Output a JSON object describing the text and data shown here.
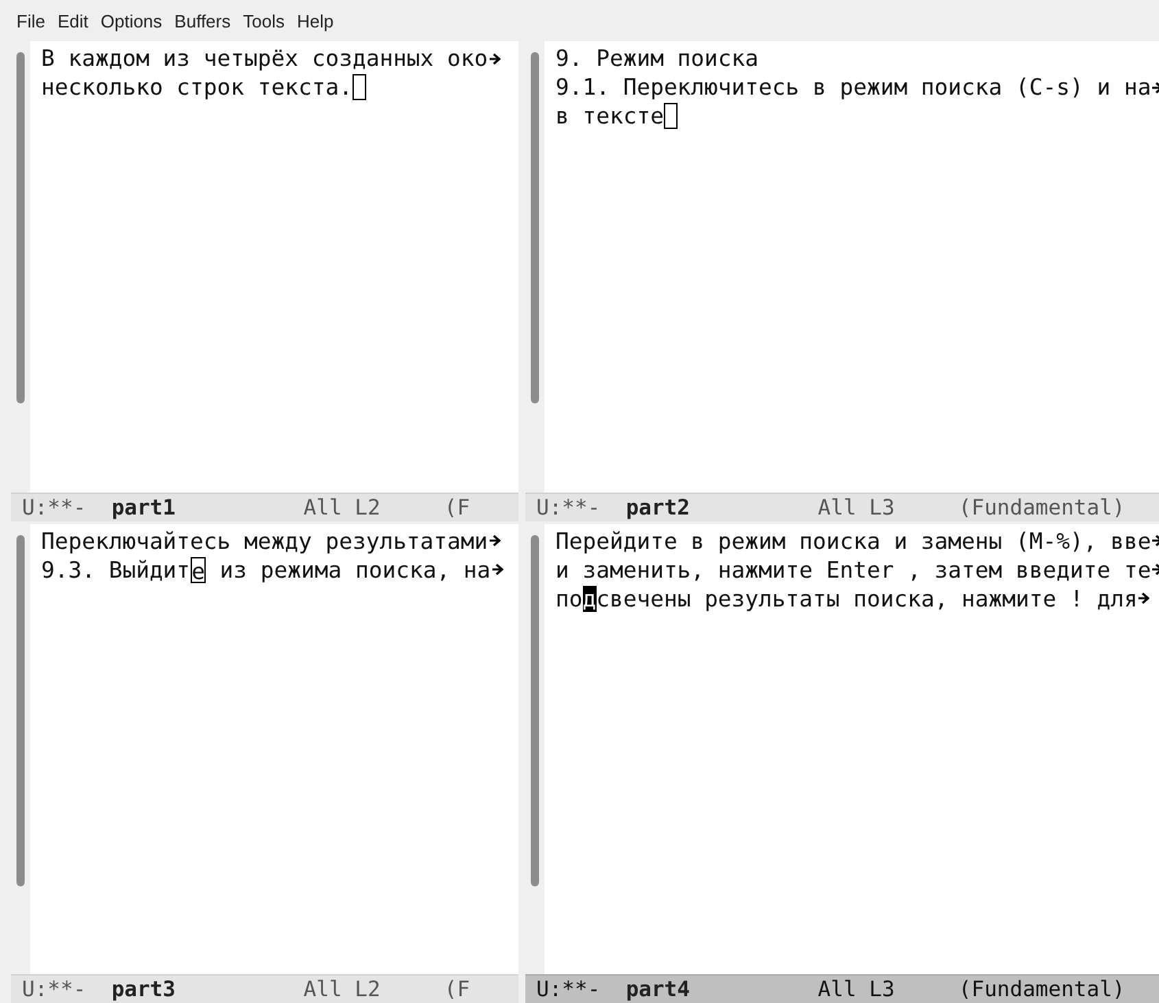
{
  "menu_bar": [
    "File",
    "Edit",
    "Options",
    "Buffers",
    "Tools",
    "Help"
  ],
  "windows": [
    {
      "active": false,
      "lines": [
        {
          "text": "В каждом из четырёх созданных око",
          "truncated": true
        },
        {
          "text": "несколько строк текста.",
          "cursor": {
            "kind": "hollow"
          },
          "truncated": false
        }
      ],
      "mode_line": {
        "status": "U:**-",
        "buffer": "part1",
        "position": "All L2",
        "mode": "(F"
      }
    },
    {
      "active": false,
      "lines": [
        {
          "text": "9. Режим поиска",
          "truncated": false
        },
        {
          "text": "9.1. Переключитесь в режим поиска (C-s) и на",
          "truncated": true
        },
        {
          "text": "в тексте",
          "cursor": {
            "kind": "hollow"
          },
          "truncated": false
        }
      ],
      "mode_line": {
        "status": "U:**-",
        "buffer": "part2",
        "position": "All L3",
        "mode": "(Fundamental)"
      }
    },
    {
      "active": false,
      "lines": [
        {
          "text": "Переключайтесь между результатами",
          "truncated": true
        },
        {
          "text": "9.3. Выйдит",
          "cursor": {
            "kind": "hollow",
            "char": "е"
          },
          "after": " из режима поиска, на",
          "truncated": true
        }
      ],
      "mode_line": {
        "status": "U:**-",
        "buffer": "part3",
        "position": "All L2",
        "mode": "(F"
      }
    },
    {
      "active": true,
      "lines": [
        {
          "text": "Перейдите в режим поиска и замены (M-%), вве",
          "truncated": true
        },
        {
          "text": "и заменить, нажмите Enter , затем введите те",
          "truncated": true
        },
        {
          "text": "по",
          "cursor": {
            "kind": "filled",
            "char": "д"
          },
          "after": "свечены результаты поиска, нажмите ! для",
          "truncated": true
        }
      ],
      "mode_line": {
        "status": "U:**-",
        "buffer": "part4",
        "position": "All L3",
        "mode": "(Fundamental)"
      }
    }
  ]
}
